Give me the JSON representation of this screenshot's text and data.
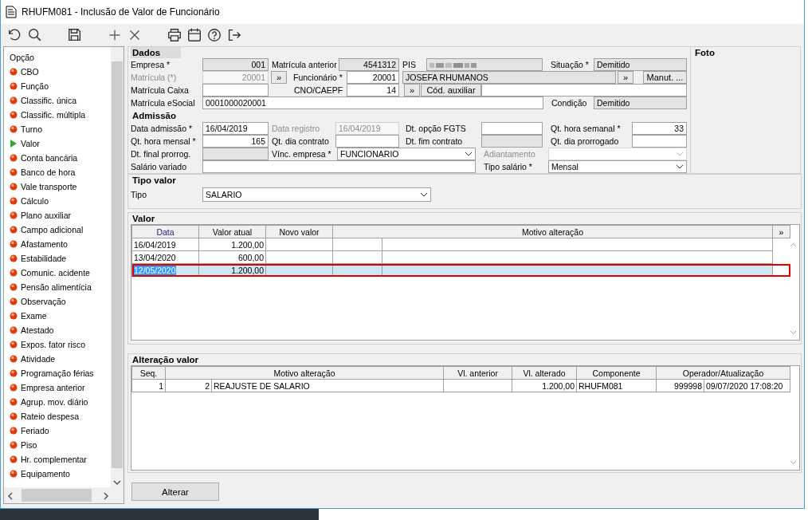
{
  "window": {
    "title": "RHUFM081 - Inclusão de Valor de Funcionário"
  },
  "sidebar": {
    "header": "Opção",
    "items": [
      {
        "label": "CBO",
        "selected": false
      },
      {
        "label": "Função",
        "selected": false
      },
      {
        "label": "Classific. única",
        "selected": false
      },
      {
        "label": "Classific. múltipla",
        "selected": false
      },
      {
        "label": "Turno",
        "selected": false
      },
      {
        "label": "Valor",
        "selected": true
      },
      {
        "label": "Conta bancária",
        "selected": false
      },
      {
        "label": "Banco de hora",
        "selected": false
      },
      {
        "label": "Vale transporte",
        "selected": false
      },
      {
        "label": "Cálculo",
        "selected": false
      },
      {
        "label": "Plano auxiliar",
        "selected": false
      },
      {
        "label": "Campo adicional",
        "selected": false
      },
      {
        "label": "Afastamento",
        "selected": false
      },
      {
        "label": "Estabilidade",
        "selected": false
      },
      {
        "label": "Comunic. acidente",
        "selected": false
      },
      {
        "label": "Pensão alimentícia",
        "selected": false
      },
      {
        "label": "Observação",
        "selected": false
      },
      {
        "label": "Exame",
        "selected": false
      },
      {
        "label": "Atestado",
        "selected": false
      },
      {
        "label": "Expos. fator risco",
        "selected": false
      },
      {
        "label": "Atividade",
        "selected": false
      },
      {
        "label": "Programação férias",
        "selected": false
      },
      {
        "label": "Empresa anterior",
        "selected": false
      },
      {
        "label": "Agrup. mov. diário",
        "selected": false
      },
      {
        "label": "Rateio despesa",
        "selected": false
      },
      {
        "label": "Feriado",
        "selected": false
      },
      {
        "label": "Piso",
        "selected": false
      },
      {
        "label": "Hr. complementar",
        "selected": false
      },
      {
        "label": "Equipamento",
        "selected": false
      }
    ]
  },
  "sections": [
    {
      "legend": "Dados",
      "rows": [
        {
          "items": [
            {
              "kind": "label",
              "text": "Empresa *",
              "disabled": false
            },
            {
              "kind": "field",
              "text": "001",
              "readonly": true,
              "disabled": false
            },
            {
              "kind": "label",
              "text": "Matrícula anterior",
              "disabled": false
            },
            {
              "kind": "field",
              "text": "4541312",
              "readonly": true,
              "disabled": false
            },
            {
              "kind": "label",
              "text": "PIS",
              "disabled": false
            },
            {
              "kind": "masked"
            },
            {
              "kind": "label",
              "text": "Situação *",
              "disabled": false
            },
            {
              "kind": "field",
              "text": "Demitido",
              "readonly": true,
              "disabled": false
            }
          ]
        },
        {
          "items": [
            {
              "kind": "label",
              "text": "Matrícula (*)",
              "disabled": true
            },
            {
              "kind": "field",
              "text": "20001",
              "readonly": false,
              "disabled": true
            },
            {
              "kind": "button",
              "text": "»"
            },
            {
              "kind": "label",
              "text": "Funcionário *",
              "disabled": false
            },
            {
              "kind": "field",
              "text": "20001",
              "readonly": false,
              "disabled": false
            },
            {
              "kind": "field",
              "text": "JOSEFA RHUMANOS",
              "readonly": true,
              "disabled": false
            },
            {
              "kind": "button",
              "text": "»"
            },
            {
              "kind": "button",
              "text": "Manut. ..."
            }
          ]
        },
        {
          "items": [
            {
              "kind": "label",
              "text": "Matrícula Caixa",
              "disabled": false
            },
            {
              "kind": "field",
              "readonly": false,
              "disabled": false
            },
            {
              "kind": "label",
              "text": "CNO/CAEPF",
              "disabled": false
            },
            {
              "kind": "field",
              "text": "14",
              "readonly": false,
              "disabled": false
            },
            {
              "kind": "button",
              "text": "»"
            },
            {
              "kind": "button",
              "text": "Cód. auxiliar"
            },
            {
              "kind": "field",
              "readonly": false,
              "disabled": false
            }
          ]
        },
        {
          "items": [
            {
              "kind": "label",
              "text": "Matrícula eSocial",
              "disabled": false
            },
            {
              "kind": "field",
              "text": "0001000020001",
              "readonly": false,
              "disabled": false
            },
            {
              "kind": "label",
              "text": "Condição",
              "disabled": false
            },
            {
              "kind": "field",
              "text": "Demitido",
              "readonly": true,
              "disabled": false
            }
          ]
        }
      ]
    },
    {
      "legend": "Admissão",
      "rows": [
        {
          "items": [
            {
              "kind": "label",
              "text": "Data admissão *",
              "disabled": false
            },
            {
              "kind": "field",
              "text": "16/04/2019",
              "readonly": false,
              "disabled": false
            },
            {
              "kind": "label",
              "text": "Data registro",
              "disabled": true
            },
            {
              "kind": "field",
              "text": "16/04/2019",
              "readonly": false,
              "disabled": true
            },
            {
              "kind": "label",
              "text": "Dt. opção FGTS",
              "disabled": false
            },
            {
              "kind": "field",
              "readonly": false,
              "disabled": false
            },
            {
              "kind": "label",
              "text": "Qt. hora semanal *",
              "disabled": false
            },
            {
              "kind": "field",
              "text": "33",
              "readonly": false,
              "disabled": false
            }
          ]
        },
        {
          "items": [
            {
              "kind": "label",
              "text": "Qt. hora mensal *",
              "disabled": false
            },
            {
              "kind": "field",
              "text": "165",
              "readonly": false,
              "disabled": false
            },
            {
              "kind": "label",
              "text": "Qt. dia contrato",
              "disabled": false
            },
            {
              "kind": "field",
              "readonly": false,
              "disabled": false
            },
            {
              "kind": "label",
              "text": "Dt. fim contrato",
              "disabled": false
            },
            {
              "kind": "field",
              "readonly": true,
              "disabled": false
            },
            {
              "kind": "label",
              "text": "Qt. dia prorrogado",
              "disabled": false
            },
            {
              "kind": "field",
              "readonly": false,
              "disabled": false
            }
          ]
        },
        {
          "items": [
            {
              "kind": "label",
              "text": "Dt. final prorrog.",
              "disabled": false
            },
            {
              "kind": "field",
              "readonly": true,
              "disabled": false
            },
            {
              "kind": "label",
              "text": "Vínc. empresa *",
              "disabled": false
            },
            {
              "kind": "select",
              "text": "FUNCIONARIO",
              "disabled": false
            },
            {
              "kind": "label",
              "text": "Adiantamento",
              "disabled": true
            },
            {
              "kind": "select",
              "disabled": true
            }
          ]
        },
        {
          "items": [
            {
              "kind": "label",
              "text": "Salário variado",
              "disabled": false
            },
            {
              "kind": "field",
              "readonly": false,
              "disabled": false
            },
            {
              "kind": "label",
              "text": "Tipo salário *",
              "disabled": false
            },
            {
              "kind": "select",
              "text": "Mensal",
              "disabled": false
            }
          ]
        }
      ]
    }
  ],
  "foto": {
    "legend": "Foto"
  },
  "tipo_valor": {
    "legend": "Tipo valor",
    "label": "Tipo",
    "value": "SALARIO"
  },
  "valor": {
    "legend": "Valor",
    "columns": [
      "Data",
      "Valor atual",
      "Novo valor",
      "Motivo alteração"
    ],
    "expand_button": "»",
    "rows": [
      {
        "data": "16/04/2019",
        "valor_atual": "1.200,00",
        "selected": false
      },
      {
        "data": "13/04/2020",
        "valor_atual": "600,00",
        "selected": false
      },
      {
        "data": "12/05/2020",
        "valor_atual": "1.200,00",
        "selected": true
      }
    ]
  },
  "alteracao": {
    "legend": "Alteração valor",
    "columns": [
      "Seq.",
      "Motivo alteração",
      "Vl. anterior",
      "Vl. alterado",
      "Componente",
      "Operador/Atualização"
    ],
    "rows": [
      {
        "seq": "1",
        "motivo_codigo": "2",
        "motivo": "REAJUSTE DE SALARIO",
        "vl_alterado": "1.200,00",
        "componente": "RHUFM081",
        "operador": "999998",
        "atualizacao": "09/07/2020 17:08:20"
      }
    ]
  },
  "action_button": "Alterar"
}
